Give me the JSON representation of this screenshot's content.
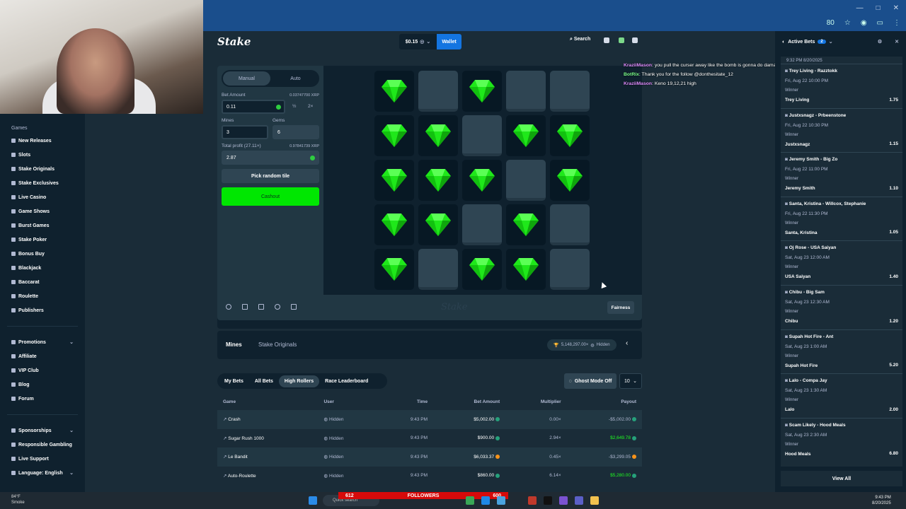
{
  "topnav": {
    "logo": "Stake",
    "balance": "$0.15",
    "wallet": "Wallet",
    "search": "Search"
  },
  "sidebar": {
    "games_label": "Games",
    "games": [
      "New Releases",
      "Slots",
      "Stake Originals",
      "Stake Exclusives",
      "Live Casino",
      "Game Shows",
      "Burst Games",
      "Stake Poker",
      "Bonus Buy",
      "Blackjack",
      "Baccarat",
      "Roulette",
      "Publishers"
    ],
    "group2": [
      "Promotions",
      "Affiliate",
      "VIP Club",
      "Blog",
      "Forum"
    ],
    "group3": [
      "Sponsorships",
      "Responsible Gambling",
      "Live Support",
      "Language: English"
    ]
  },
  "controls": {
    "manual": "Manual",
    "auto": "Auto",
    "bet_amount_label": "Bet Amount",
    "bet_amount_crypto": "0.03747700 XRP",
    "bet_amount": "0.11",
    "half": "½",
    "double": "2×",
    "mines_label": "Mines",
    "mines": "3",
    "gems_label": "Gems",
    "gems": "6",
    "profit_label": "Total profit (27.11×)",
    "profit_crypto": "0.97841739 XRP",
    "profit": "2.87",
    "random": "Pick random tile",
    "cashout": "Cashout"
  },
  "board": [
    [
      "gem",
      "hidden",
      "gem",
      "hidden",
      "hidden"
    ],
    [
      "gem",
      "gem",
      "hidden",
      "gem",
      "gem"
    ],
    [
      "gem",
      "gem",
      "gem",
      "hidden",
      "gem"
    ],
    [
      "gem",
      "gem",
      "hidden",
      "gem",
      "hidden"
    ],
    [
      "gem",
      "hidden",
      "gem",
      "gem",
      "hidden"
    ]
  ],
  "gamebar": {
    "logo": "Stake",
    "fairness": "Fairness"
  },
  "info": {
    "title": "Mines",
    "subtitle": "Stake Originals",
    "leader_amount": "5,148,297.00×",
    "leader_user": "Hidden"
  },
  "bets": {
    "tabs": [
      "My Bets",
      "All Bets",
      "High Rollers",
      "Race Leaderboard"
    ],
    "ghost": "Ghost Mode Off",
    "count": "10",
    "headers": [
      "Game",
      "User",
      "Time",
      "Bet Amount",
      "Multiplier",
      "Payout"
    ],
    "rows": [
      {
        "game": "Crash",
        "user": "Hidden",
        "time": "9:43 PM",
        "bet": "$5,002.00",
        "coin": "g",
        "mult": "0.00×",
        "payout": "-$5,002.00",
        "pcoin": "g",
        "win": false
      },
      {
        "game": "Sugar Rush 1000",
        "user": "Hidden",
        "time": "9:43 PM",
        "bet": "$900.00",
        "coin": "g",
        "mult": "2.94×",
        "payout": "$2,649.78",
        "pcoin": "g",
        "win": true
      },
      {
        "game": "Le Bandit",
        "user": "Hidden",
        "time": "9:43 PM",
        "bet": "$6,033.37",
        "coin": "o",
        "mult": "0.45×",
        "payout": "-$3,299.05",
        "pcoin": "o",
        "win": false
      },
      {
        "game": "Auto-Roulette",
        "user": "Hidden",
        "time": "9:43 PM",
        "bet": "$860.00",
        "coin": "g",
        "mult": "6.14×",
        "payout": "$5,280.00",
        "pcoin": "g",
        "win": true
      }
    ]
  },
  "chat": [
    {
      "user": "KraziiMason",
      "text": ": you pull the curser away like the bomb is gonna do damage or sum 😂",
      "cls": "u1"
    },
    {
      "user": "BotRix",
      "text": ": Thank you for the follow @donthesitate_12",
      "cls": "u2"
    },
    {
      "user": "KraziiMason",
      "text": ": Keno 19,12,21 high",
      "cls": "u1"
    }
  ],
  "active_bets": {
    "title": "Active Bets",
    "count": "2",
    "stamp": "9:32 PM 8/20/2025",
    "view_all": "View All",
    "cards": [
      {
        "title": "Trey Living - Razztokk",
        "date": "Fri, Aug 22 10:00 PM",
        "label": "Winner",
        "pick": "Trey Living",
        "odds": "1.75"
      },
      {
        "title": "Justxsnagz - Prbeenstone",
        "date": "Fri, Aug 22 10:30 PM",
        "label": "Winner",
        "pick": "Justxsnagz",
        "odds": "1.15"
      },
      {
        "title": "Jeremy Smith - Big Zo",
        "date": "Fri, Aug 22 11:00 PM",
        "label": "Winner",
        "pick": "Jeremy Smith",
        "odds": "1.10"
      },
      {
        "title": "Santa, Kristina - Willcox, Stephanie",
        "date": "Fri, Aug 22 11:30 PM",
        "label": "Winner",
        "pick": "Santa, Kristina",
        "odds": "1.05"
      },
      {
        "title": "Oj Rose - USA Saiyan",
        "date": "Sat, Aug 23 12:00 AM",
        "label": "Winner",
        "pick": "USA Saiyan",
        "odds": "1.40"
      },
      {
        "title": "Chibu - Big Sam",
        "date": "Sat, Aug 23 12:30 AM",
        "label": "Winner",
        "pick": "Chibu",
        "odds": "1.20"
      },
      {
        "title": "Supah Hot Fire - Ant",
        "date": "Sat, Aug 23 1:00 AM",
        "label": "Winner",
        "pick": "Supah Hot Fire",
        "odds": "5.20"
      },
      {
        "title": "Lalo - Compa Jay",
        "date": "Sat, Aug 23 1:30 AM",
        "label": "Winner",
        "pick": "Lalo",
        "odds": "2.00"
      },
      {
        "title": "Scam Likely - Hood Meals",
        "date": "Sat, Aug 23 2:30 AM",
        "label": "Winner",
        "pick": "Hood Meals",
        "odds": "6.80"
      }
    ]
  },
  "taskbar": {
    "temp": "84°F",
    "weather": "Smoke",
    "search": "Quick search",
    "time": "9:43 PM",
    "date": "8/20/2025",
    "followers_left": "612",
    "followers_label": "FOLLOWERS",
    "followers_right": "600"
  },
  "chrome": {
    "zoom": "80"
  }
}
